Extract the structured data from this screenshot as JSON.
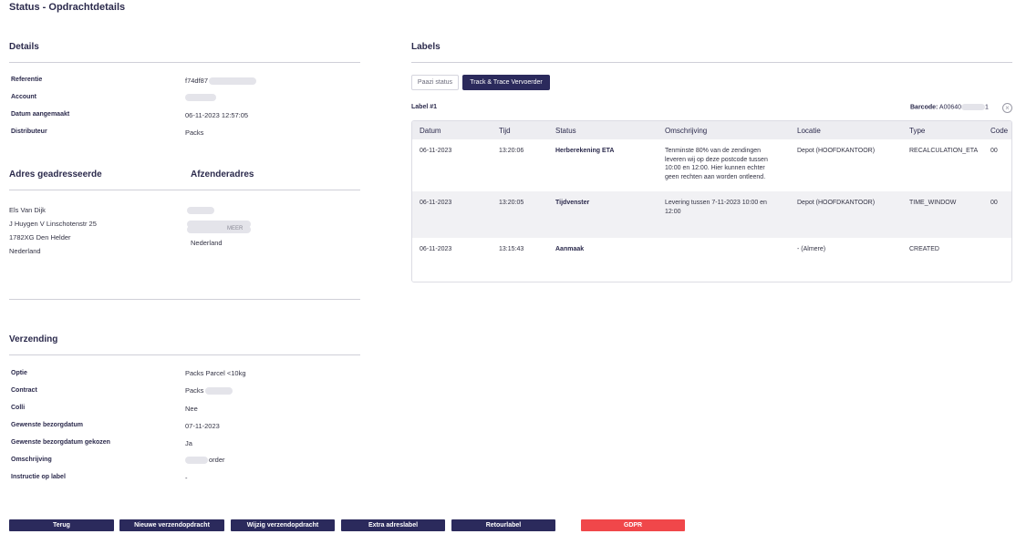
{
  "page_title": "Status - Opdrachtdetails",
  "details": {
    "title": "Details",
    "rows": [
      {
        "label": "Referentie",
        "value": "f74df87"
      },
      {
        "label": "Account",
        "value": ""
      },
      {
        "label": "Datum aangemaakt",
        "value": "06-11-2023 12:57:05"
      },
      {
        "label": "Distributeur",
        "value": "Packs"
      }
    ]
  },
  "addressee": {
    "title": "Adres geadresseerde",
    "lines": [
      "Els Van Dijk",
      "J Huygen V Linschotenstr 25",
      "1782XG Den Helder",
      "Nederland"
    ]
  },
  "sender": {
    "title": "Afzenderadres",
    "country": "Nederland",
    "partial_text": "MEER"
  },
  "shipping": {
    "title": "Verzending",
    "rows": [
      {
        "label": "Optie",
        "value": "Packs Parcel <10kg"
      },
      {
        "label": "Contract",
        "value": "Packs"
      },
      {
        "label": "Colli",
        "value": "Nee"
      },
      {
        "label": "Gewenste bezorgdatum",
        "value": "07-11-2023"
      },
      {
        "label": "Gewenste bezorgdatum gekozen",
        "value": "Ja"
      },
      {
        "label": "Omschrijving",
        "value": "order"
      },
      {
        "label": "Instructie op label",
        "value": "-"
      }
    ]
  },
  "labels": {
    "title": "Labels",
    "tabs": [
      "Paazi status",
      "Track & Trace Vervoerder"
    ],
    "label_name": "Label #1",
    "barcode_label": "Barcode:",
    "barcode_value": "A00640",
    "barcode_suffix": "1",
    "columns": [
      "Datum",
      "Tijd",
      "Status",
      "Omschrijving",
      "Locatie",
      "Type",
      "Code"
    ],
    "rows": [
      {
        "datum": "06-11-2023",
        "tijd": "13:20:06",
        "status": "Herberekening ETA",
        "omschrijving": [
          "Tenminste 80% van de zendingen",
          "leveren wij op deze postcode tussen",
          "10:00 en 12:00. Hier kunnen echter",
          "geen rechten aan worden ontleend."
        ],
        "locatie": "Depot (HOOFDKANTOOR)",
        "type": "RECALCULATION_ETA",
        "code": "00"
      },
      {
        "datum": "06-11-2023",
        "tijd": "13:20:05",
        "status": "Tijdvenster",
        "omschrijving": [
          "Levering tussen 7-11-2023 10:00 en",
          "12:00"
        ],
        "locatie": "Depot (HOOFDKANTOOR)",
        "type": "TIME_WINDOW",
        "code": "00"
      },
      {
        "datum": "06-11-2023",
        "tijd": "13:15:43",
        "status": "Aanmaak",
        "omschrijving": [],
        "locatie": "- (Almere)",
        "type": "CREATED",
        "code": ""
      }
    ]
  },
  "buttons": {
    "back": "Terug",
    "new_order": "Nieuwe verzendopdracht",
    "edit_order": "Wijzig verzendopdracht",
    "extra_label": "Extra adreslabel",
    "return_label": "Retourlabel",
    "gdpr": "GDPR"
  },
  "colors": {
    "primary": "#2b2a5c",
    "danger": "#f0474a",
    "table_header_bg": "#ededf1"
  }
}
